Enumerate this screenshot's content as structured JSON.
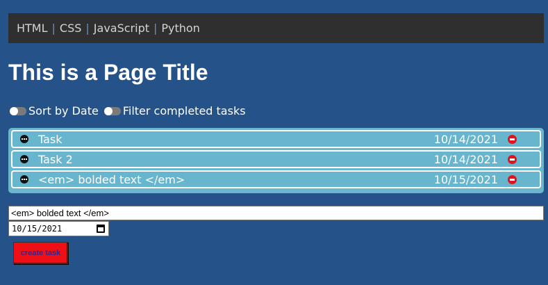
{
  "nav": {
    "items": [
      {
        "label": "HTML"
      },
      {
        "label": "CSS"
      },
      {
        "label": "JavaScript"
      },
      {
        "label": "Python"
      }
    ],
    "separator": "|"
  },
  "page_title": "This is a Page Title",
  "toggles": {
    "sort_by_date": {
      "label": "Sort by Date",
      "on": false
    },
    "filter_completed": {
      "label": "Filter completed tasks",
      "on": false
    }
  },
  "tasks": [
    {
      "name": "Task",
      "date": "10/14/2021",
      "status_icon": "more-icon",
      "delete_icon": "remove-icon"
    },
    {
      "name": "Task 2",
      "date": "10/14/2021",
      "status_icon": "more-icon",
      "delete_icon": "remove-icon"
    },
    {
      "name": "<em> bolded text </em>",
      "date": "10/15/2021",
      "status_icon": "more-icon",
      "delete_icon": "remove-icon"
    }
  ],
  "form": {
    "text_value": "<em> bolded text </em>",
    "date_value": "10/15/2021",
    "create_label": "create task"
  },
  "colors": {
    "background": "#245289",
    "nav_bg": "#2f2f2f",
    "task_bg": "#68b5ce",
    "delete": "#e0141e",
    "button_bg": "#f00f14",
    "button_text": "#2a2a9a"
  }
}
